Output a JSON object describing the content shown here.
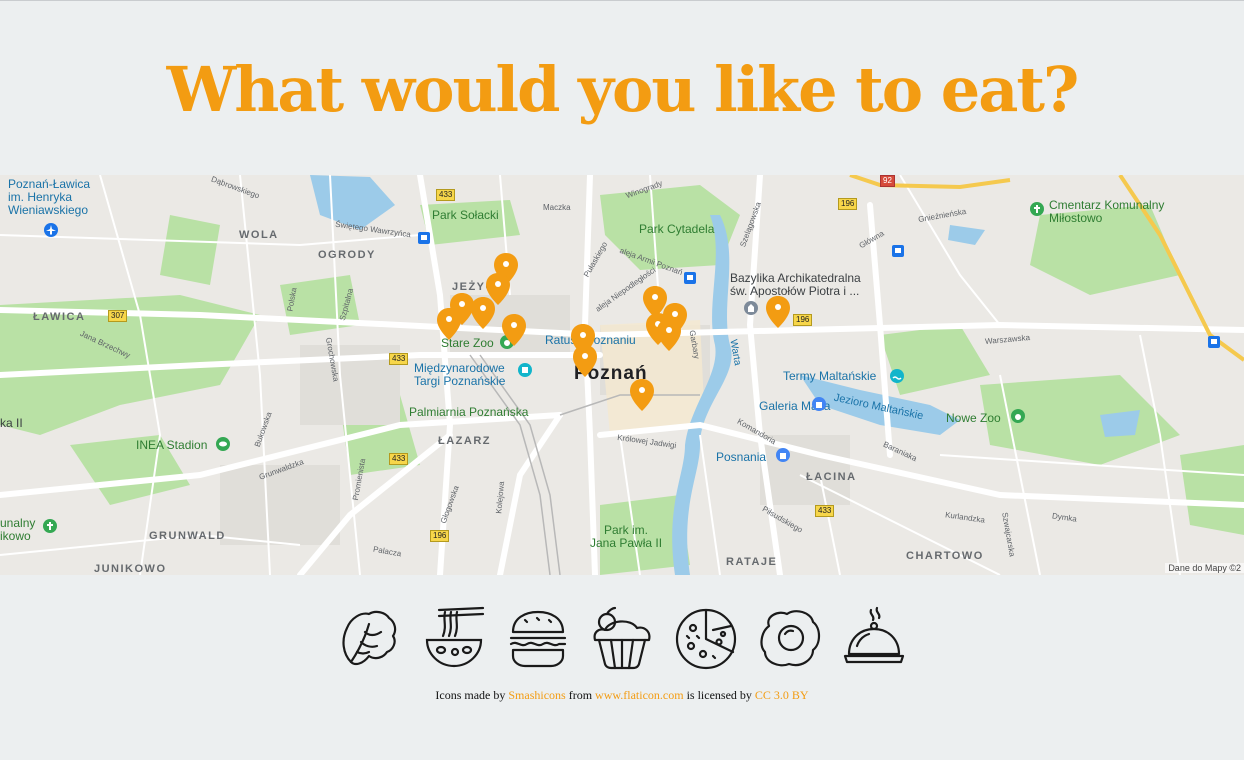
{
  "page": {
    "title": "What would you like to eat?",
    "accent": "#f39c12",
    "background": "#eceff0"
  },
  "map": {
    "city_label": "Poznań",
    "attribution": "Dane do Mapy ©2",
    "labels": {
      "poznan_lawica": "Poznań-Ławica",
      "henryka_1": "im. Henryka",
      "henryka_2": "Wieniawskiego",
      "wola": "WOLA",
      "ogrody": "OGRODY",
      "lawica": "ŁAWICA",
      "park_solacki": "Park Sołacki",
      "jezyce": "JEŻYCE",
      "stare_zoo": "Stare Zoo",
      "park_cytadela": "Park Cytadela",
      "bazylika_1": "Bazylika Archikatedralna",
      "bazylika_2": "św. Apostołów Piotra i ...",
      "cmentarz_1": "Cmentarz Komunalny",
      "cmentarz_2": "Miłostowo",
      "ratusz": "Ratusz Poznaniu",
      "mtp_1": "Międzynarodowe",
      "mtp_2": "Targi Poznańskie",
      "termy": "Termy Maltańskie",
      "palmiarnia": "Palmiarnia Poznańska",
      "galeria_malta": "Galeria Malta",
      "jezioro": "Jezioro Maltańskie",
      "nowe_zoo": "Nowe Zoo",
      "inea": "INEA Stadion",
      "lazarz": "ŁAZARZ",
      "posnania": "Posnania",
      "lacina": "ŁACINA",
      "unalny_1": "unalny",
      "unalny_2": "ikowo",
      "grunwald": "GRUNWALD",
      "junikowo": "JUNIKOWO",
      "park_jp2_1": "Park im.",
      "park_jp2_2": "Jana Pawła II",
      "rataje": "RATAJE",
      "chartowo": "CHARTOWO",
      "warta": "Warta",
      "ka_ii": "ka II"
    },
    "shields": {
      "s433a": "433",
      "s433b": "433",
      "s433c": "433",
      "s433d": "433",
      "s307": "307",
      "s196a": "196",
      "s196b": "196",
      "s196c": "196",
      "s92": "92"
    },
    "streets": {
      "dabrowskiego": "Dąbrowskiego",
      "wawrzynca": "Świętego Wawrzyńca",
      "maczka": "Maczka",
      "winogrady": "Winogrady",
      "szelagowska": "Szelągowska",
      "glowna": "Główna",
      "gnieznienska": "Gnieźnieńska",
      "warszawska": "Warszawska",
      "brzechwy": "Jana Brzechwy",
      "bukowska": "Bukowska",
      "grunwaldzka": "Grunwaldzka",
      "glogowska": "Głogowska",
      "krolowej": "Królowej Jadwigi",
      "kurlandzka": "Kurlandzka",
      "dymka": "Dymka",
      "pilsudskiego": "Piłsudskiego",
      "baraniaka": "Baraniaka",
      "garbary": "Garbary",
      "komandoria": "Komandoria",
      "polska": "Polska",
      "szpitalna": "Szpitalna",
      "grochowska": "Grochowska",
      "promienista": "Promienista",
      "kolejowa": "Kolejowa",
      "palacza": "Palacza",
      "szwajcarska": "Szwajcarska",
      "armii": "aleja Armii Poznań",
      "niepodleglosci": "aleja Niepodległości",
      "pulaskiego": "Pułaskiego"
    }
  },
  "categories": [
    {
      "name": "salad",
      "icon": "lettuce-icon"
    },
    {
      "name": "noodles",
      "icon": "noodle-bowl-icon"
    },
    {
      "name": "burger",
      "icon": "burger-icon"
    },
    {
      "name": "dessert",
      "icon": "cupcake-icon"
    },
    {
      "name": "pizza",
      "icon": "pizza-icon"
    },
    {
      "name": "breakfast",
      "icon": "fried-egg-icon"
    },
    {
      "name": "dinner",
      "icon": "cloche-icon"
    }
  ],
  "credits": {
    "prefix": "Icons made by",
    "author": "Smashicons",
    "from": "from",
    "site": "www.flaticon.com",
    "licensed": "is licensed by",
    "license": "CC 3.0 BY"
  }
}
